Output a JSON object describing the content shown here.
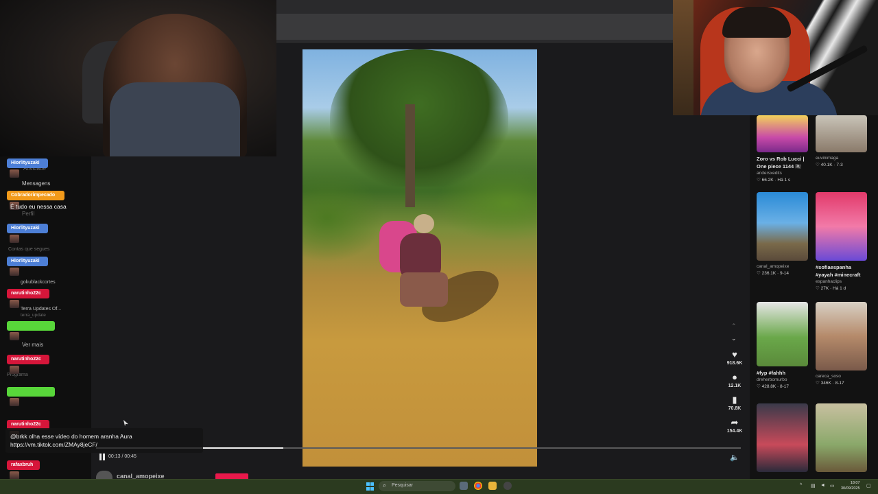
{
  "video": {
    "elapsed": "00:13",
    "duration": "00:45",
    "progress_fraction": 0.29,
    "author": "canal_amopeixe",
    "likes": "918.6K",
    "comments": "12.1K",
    "saves": "70.8K",
    "shares": "154.4K"
  },
  "sidebar_faint": {
    "atividade": "Atividade",
    "perfil": "Perfil",
    "contas_label": "Contas que segues",
    "account_1": "gokublackcortes",
    "account_2": "Terra Updates Of...",
    "account_2_sub": "terra_update",
    "ver_mais": "Ver mais",
    "programa": "Programa"
  },
  "sidebar_strong": {
    "mensagens": "Mensagens"
  },
  "chat": {
    "messages": [
      {
        "user": "Hiorlityuzaki",
        "color": "#4d7fd6",
        "text": ""
      },
      {
        "user": "Cobradorimpecado",
        "color": "#f29a1a",
        "text": "É tudo eu nessa casa"
      },
      {
        "user": "Hiorlityuzaki",
        "color": "#4d7fd6",
        "text": ""
      },
      {
        "user": "Hiorlityuzaki",
        "color": "#4d7fd6",
        "text": ""
      },
      {
        "user": "narutinho22c",
        "color": "#d6163a",
        "text": ""
      },
      {
        "user": "",
        "color": "#58d63a",
        "text": ""
      },
      {
        "user": "narutinho22c",
        "color": "#d6163a",
        "text": ""
      },
      {
        "user": "",
        "color": "#58d63a",
        "text": ""
      },
      {
        "user": "narutinho22c",
        "color": "#d6163a",
        "text": ""
      },
      {
        "user": "rafaxbruh",
        "color": "#d6163a",
        "text": ""
      }
    ],
    "last_message_line1": "@brkk olha esse vídeo do homem aranha Aura",
    "last_message_line2": "https://vm.tiktok.com/ZMAy8jeCF/"
  },
  "feed": [
    {
      "caption1": "Zoro vs Rob Lucci |",
      "caption2": "One piece 1144 🏴‍☠️",
      "author": "andersxedits",
      "stats": "♡ 66.2K · Há 1 s"
    },
    {
      "caption1": "",
      "caption2": "",
      "author": "euvinimaga",
      "stats": "♡ 40.1K · 7-3"
    },
    {
      "caption1": "",
      "caption2": "",
      "author": "canal_amopeixe",
      "stats": "♡ 236.1K · 9-14"
    },
    {
      "caption1": "#sofiaespanha",
      "caption2": "#yayah #minecraft",
      "author": "espanhaclips",
      "stats": "♡ 27K · Há 1 d"
    },
    {
      "caption1": "#fyp #fahhh",
      "caption2": "",
      "author": "dreherbomurbo",
      "stats": "♡ 428.8K · 8-17"
    },
    {
      "caption1": "",
      "caption2": "",
      "author": "careca_soso",
      "stats": "♡ 346K · 8-17"
    }
  ],
  "taskbar": {
    "search_placeholder": "Pesquisar",
    "time": "18:07",
    "date": "30/09/2025"
  }
}
